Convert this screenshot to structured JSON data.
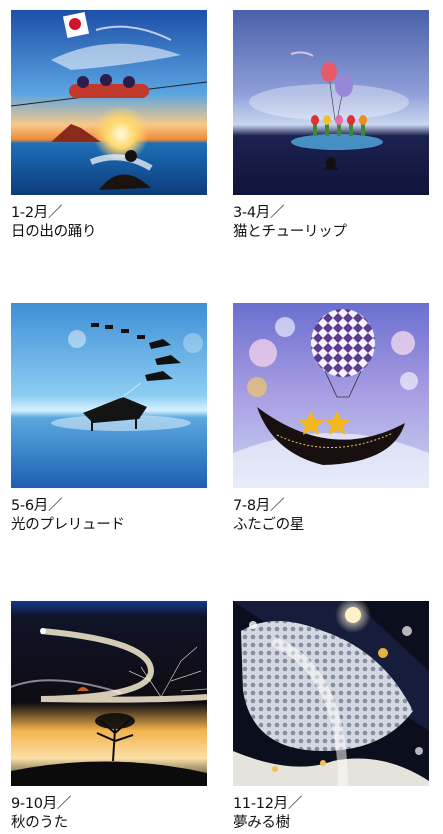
{
  "items": [
    {
      "months": "1-2月／",
      "title": "日の出の踊り"
    },
    {
      "months": "3-4月／",
      "title": "猫とチューリップ"
    },
    {
      "months": "5-6月／",
      "title": "光のプレリュード"
    },
    {
      "months": "7-8月／",
      "title": "ふたごの星"
    },
    {
      "months": "9-10月／",
      "title": "秋のうた"
    },
    {
      "months": "11-12月／",
      "title": "夢みる樹"
    }
  ]
}
